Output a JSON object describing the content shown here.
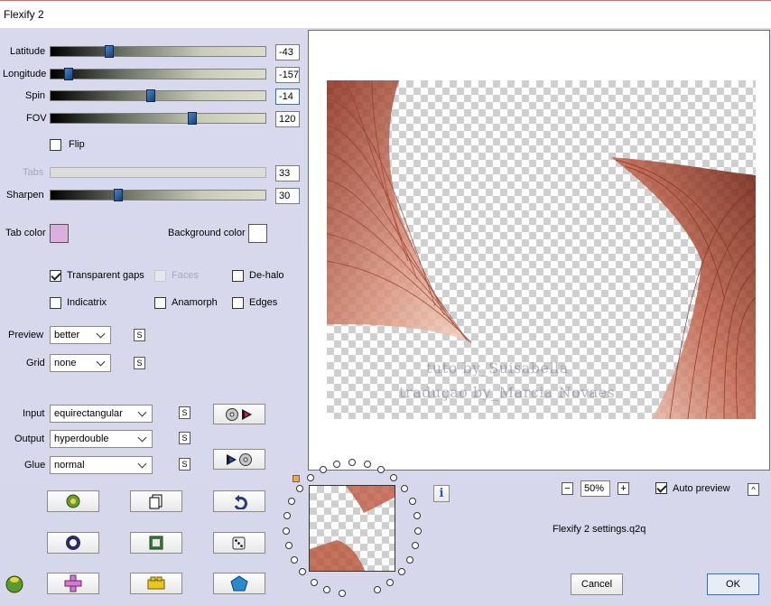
{
  "window": {
    "title": "Flexify 2"
  },
  "sliders": [
    {
      "label": "Latitude",
      "value": "-43",
      "pos": 0.27,
      "disabled": false
    },
    {
      "label": "Longitude",
      "value": "-157",
      "pos": 0.08,
      "disabled": false
    },
    {
      "label": "Spin",
      "value": "-14",
      "pos": 0.46,
      "disabled": false,
      "focus": true
    },
    {
      "label": "FOV",
      "value": "120",
      "pos": 0.67,
      "disabled": false
    }
  ],
  "flip": {
    "label": "Flip",
    "checked": false
  },
  "tabs": {
    "label": "Tabs",
    "value": "33",
    "disabled": true
  },
  "sharpen": {
    "label": "Sharpen",
    "value": "30",
    "pos": 0.31
  },
  "colors": {
    "tab_label": "Tab color",
    "tab_value": "#dcb0dc",
    "bg_label": "Background color",
    "bg_value": "#ffffff"
  },
  "checks": {
    "transparent_gaps": {
      "label": "Transparent gaps",
      "checked": true
    },
    "faces": {
      "label": "Faces",
      "checked": false,
      "disabled": true
    },
    "dehalo": {
      "label": "De-halo",
      "checked": false
    },
    "indicatrix": {
      "label": "Indicatrix",
      "checked": false
    },
    "anamorph": {
      "label": "Anamorph",
      "checked": false
    },
    "edges": {
      "label": "Edges",
      "checked": false
    }
  },
  "preview_select": {
    "label": "Preview",
    "value": "better"
  },
  "grid_select": {
    "label": "Grid",
    "value": "none"
  },
  "input_select": {
    "label": "Input",
    "value": "equirectangular"
  },
  "output_select": {
    "label": "Output",
    "value": "hyperdouble"
  },
  "glue_select": {
    "label": "Glue",
    "value": "normal"
  },
  "small_s": "S",
  "watermark": {
    "line1": "tuto by_Suisabella",
    "line2": "traduçao by_Marcia Novaes"
  },
  "zoom": {
    "minus": "−",
    "value": "50%",
    "plus": "+"
  },
  "auto_preview": {
    "label": "Auto preview",
    "checked": true
  },
  "expand_btn": "^",
  "info_btn": "i",
  "settings_file": "Flexify 2 settings.q2q",
  "buttons": {
    "cancel": "Cancel",
    "ok": "OK"
  },
  "accent": {
    "focus_border": "#2a6fd1",
    "thumb": "#1f4a86",
    "image_tone": "#b85a40"
  }
}
